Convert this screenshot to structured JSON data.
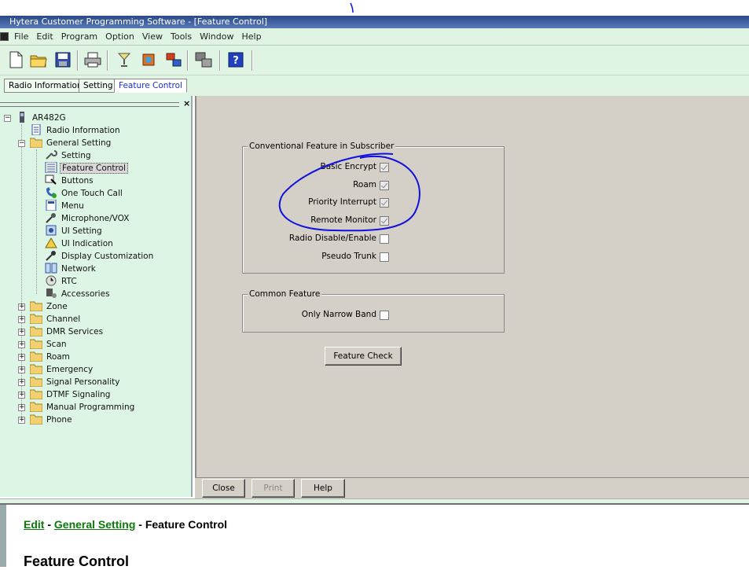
{
  "window": {
    "title": "Hytera Customer Programming Software - [Feature Control]"
  },
  "menu": [
    "File",
    "Edit",
    "Program",
    "Option",
    "View",
    "Tools",
    "Window",
    "Help"
  ],
  "toolbar": {
    "icons": [
      "new-file-icon",
      "open-folder-icon",
      "save-icon",
      "print-icon",
      "read-radio-icon",
      "write-radio-icon",
      "transfer-icon",
      "compare-icon",
      "help-icon"
    ]
  },
  "tabs": [
    {
      "label": "Radio Information",
      "active": false
    },
    {
      "label": "Setting",
      "active": false
    },
    {
      "label": "Feature Control",
      "active": true
    }
  ],
  "tree": {
    "close": "×",
    "root": "AR482G",
    "items": [
      {
        "label": "Radio Information",
        "icon": "document-icon"
      },
      {
        "label": "General Setting",
        "icon": "open-folder-icon"
      },
      {
        "label": "Setting",
        "icon": "wrench-icon"
      },
      {
        "label": "Feature Control",
        "icon": "list-icon",
        "selected": true
      },
      {
        "label": "Buttons",
        "icon": "button-icon"
      },
      {
        "label": "One Touch Call",
        "icon": "phone-icon"
      },
      {
        "label": "Menu",
        "icon": "menu-icon"
      },
      {
        "label": "Microphone/VOX",
        "icon": "microphone-icon"
      },
      {
        "label": "UI Setting",
        "icon": "ui-setting-icon"
      },
      {
        "label": "UI Indication",
        "icon": "indication-icon"
      },
      {
        "label": "Display Customization",
        "icon": "display-icon"
      },
      {
        "label": "Network",
        "icon": "network-icon"
      },
      {
        "label": "RTC",
        "icon": "clock-icon"
      },
      {
        "label": "Accessories",
        "icon": "accessories-icon"
      },
      {
        "label": "Zone",
        "icon": "folder-icon"
      },
      {
        "label": "Channel",
        "icon": "folder-icon"
      },
      {
        "label": "DMR Services",
        "icon": "folder-icon"
      },
      {
        "label": "Scan",
        "icon": "folder-icon"
      },
      {
        "label": "Roam",
        "icon": "folder-icon"
      },
      {
        "label": "Emergency",
        "icon": "folder-icon"
      },
      {
        "label": "Signal Personality",
        "icon": "folder-icon"
      },
      {
        "label": "DTMF Signaling",
        "icon": "folder-icon"
      },
      {
        "label": "Manual Programming",
        "icon": "folder-icon"
      },
      {
        "label": "Phone",
        "icon": "folder-icon"
      }
    ]
  },
  "conventional": {
    "title": "Conventional Feature in Subscriber",
    "features": [
      {
        "label": "Basic Encrypt",
        "checked": true,
        "disabled": true
      },
      {
        "label": "Roam",
        "checked": true,
        "disabled": true
      },
      {
        "label": "Priority Interrupt",
        "checked": true,
        "disabled": true
      },
      {
        "label": "Remote Monitor",
        "checked": true,
        "disabled": true
      },
      {
        "label": "Radio Disable/Enable",
        "checked": false
      },
      {
        "label": "Pseudo Trunk",
        "checked": false
      }
    ]
  },
  "common": {
    "title": "Common Feature",
    "features": [
      {
        "label": "Only Narrow Band",
        "checked": false
      }
    ]
  },
  "buttons": {
    "feature_check": "Feature Check",
    "close": "Close",
    "print": "Print",
    "help": "Help"
  },
  "help": {
    "crumb1": "Edit",
    "sep1": " - ",
    "crumb2": "General Setting",
    "sep2": " - ",
    "crumb3": "Feature Control",
    "heading": "Feature Control"
  },
  "colors": {
    "tree_bg": "#dcf5e4",
    "panel_bg": "#d4d0c8",
    "active_tab_text": "#1a2fd0",
    "link_green": "#0a7a0a",
    "annotation_blue": "#1010e0"
  }
}
